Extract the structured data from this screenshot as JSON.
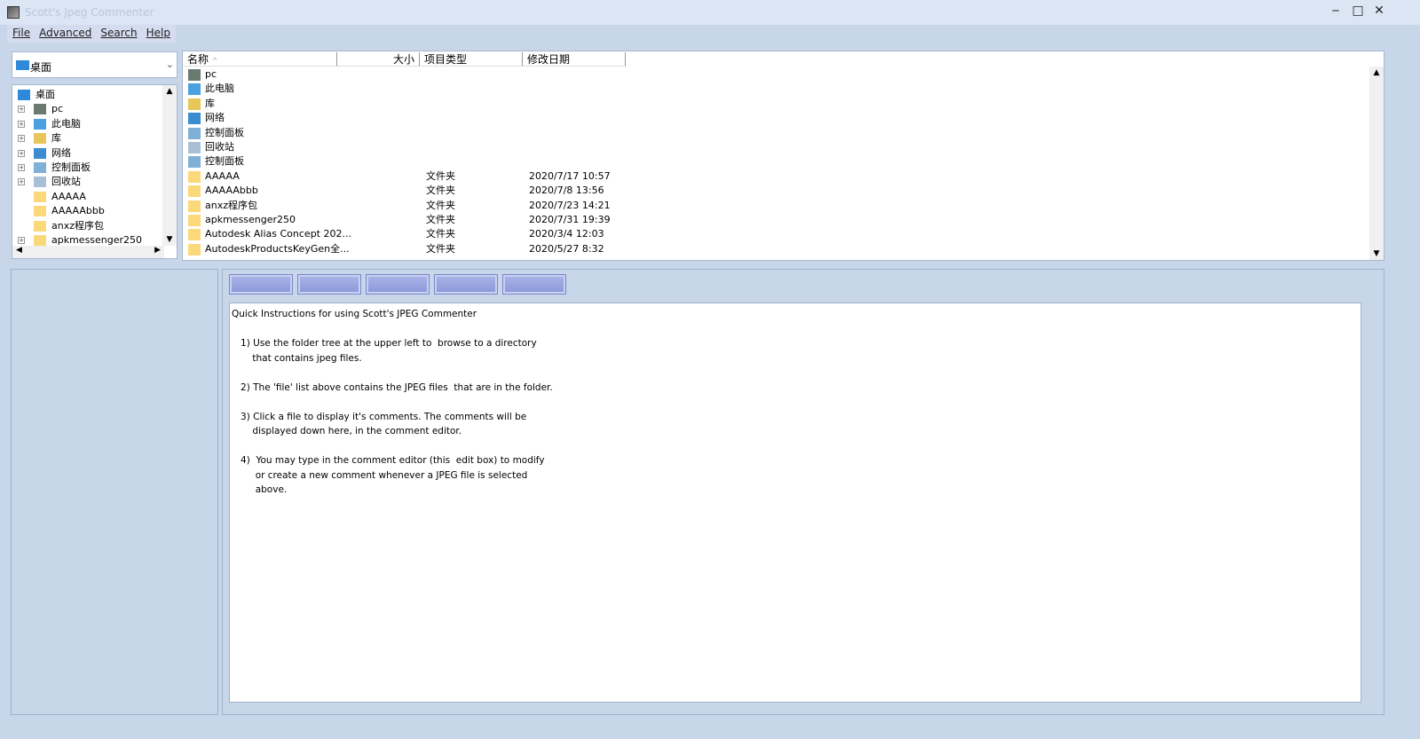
{
  "window": {
    "title": "Scott's Jpeg Commenter"
  },
  "menu": [
    "File",
    "Advanced",
    "Search",
    "Help"
  ],
  "location": {
    "value": "桌面"
  },
  "tree": [
    {
      "label": "桌面",
      "expander": false,
      "icon": "desktop-icon"
    },
    {
      "label": "pc",
      "expander": true,
      "icon": "user-icon"
    },
    {
      "label": "此电脑",
      "expander": true,
      "icon": "computer-icon"
    },
    {
      "label": "库",
      "expander": true,
      "icon": "library-icon"
    },
    {
      "label": "网络",
      "expander": true,
      "icon": "network-icon"
    },
    {
      "label": "控制面板",
      "expander": true,
      "icon": "control-panel-icon"
    },
    {
      "label": "回收站",
      "expander": true,
      "icon": "recycle-bin-icon"
    },
    {
      "label": "AAAAA",
      "expander": false,
      "icon": "folder-icon"
    },
    {
      "label": "AAAAAbbb",
      "expander": false,
      "icon": "folder-icon"
    },
    {
      "label": "anxz程序包",
      "expander": false,
      "icon": "folder-icon"
    },
    {
      "label": "apkmessenger250",
      "expander": true,
      "icon": "folder-icon"
    }
  ],
  "columns": [
    "名称",
    "大小",
    "项目类型",
    "修改日期"
  ],
  "files": [
    {
      "name": "pc",
      "type": "",
      "date": "",
      "icon": "user-icon"
    },
    {
      "name": "此电脑",
      "type": "",
      "date": "",
      "icon": "computer-icon"
    },
    {
      "name": "库",
      "type": "",
      "date": "",
      "icon": "library-icon"
    },
    {
      "name": "网络",
      "type": "",
      "date": "",
      "icon": "network-icon"
    },
    {
      "name": "控制面板",
      "type": "",
      "date": "",
      "icon": "control-panel-icon"
    },
    {
      "name": "回收站",
      "type": "",
      "date": "",
      "icon": "recycle-bin-icon"
    },
    {
      "name": "控制面板",
      "type": "",
      "date": "",
      "icon": "control-panel-icon"
    },
    {
      "name": "AAAAA",
      "type": "文件夹",
      "date": "2020/7/17 10:57",
      "icon": "folder-icon"
    },
    {
      "name": "AAAAAbbb",
      "type": "文件夹",
      "date": "2020/7/8 13:56",
      "icon": "folder-icon"
    },
    {
      "name": "anxz程序包",
      "type": "文件夹",
      "date": "2020/7/23 14:21",
      "icon": "folder-icon"
    },
    {
      "name": "apkmessenger250",
      "type": "文件夹",
      "date": "2020/7/31 19:39",
      "icon": "folder-icon"
    },
    {
      "name": "Autodesk Alias Concept 202...",
      "type": "文件夹",
      "date": "2020/3/4 12:03",
      "icon": "folder-icon"
    },
    {
      "name": "AutodeskProductsKeyGen全...",
      "type": "文件夹",
      "date": "2020/5/27 8:32",
      "icon": "folder-icon"
    }
  ],
  "editor": {
    "text": "Quick Instructions for using Scott's JPEG Commenter\n\n   1) Use the folder tree at the upper left to  browse to a directory\n       that contains jpeg files.\n\n   2) The 'file' list above contains the JPEG files  that are in the folder.\n\n   3) Click a file to display it's comments. The comments will be\n       displayed down here, in the comment editor.\n\n   4)  You may type in the comment editor (this  edit box) to modify\n        or create a new comment whenever a JPEG file is selected\n        above."
  }
}
